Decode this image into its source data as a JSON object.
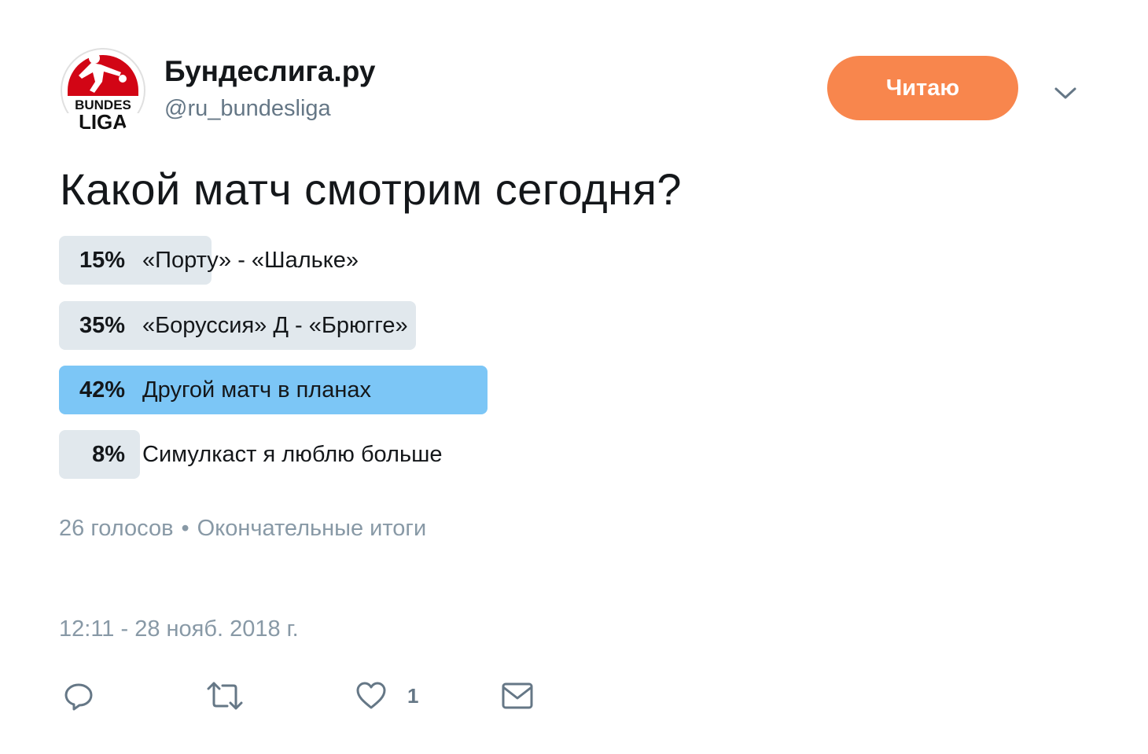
{
  "author": {
    "name": "Бундеслига.ру",
    "handle": "@ru_bundesliga",
    "avatar_icon": "bundesliga-logo",
    "avatar_text_top": "BUNDES",
    "avatar_text_bottom": "LIGA"
  },
  "follow_button": {
    "label": "Читаю",
    "color": "#f8864d"
  },
  "menu_icon": "chevron-down-icon",
  "question": "Какой матч смотрим сегодня?",
  "poll": {
    "options": [
      {
        "percent": "15%",
        "value": 15,
        "label": "«Порту» - «Шальке»"
      },
      {
        "percent": "35%",
        "value": 35,
        "label": "«Боруссия» Д - «Брюгге»"
      },
      {
        "percent": "42%",
        "value": 42,
        "label": "Другой матч в планах",
        "winner": true
      },
      {
        "percent": "8%",
        "value": 8,
        "label": "Симулкаст я люблю больше"
      }
    ],
    "votes": "26 голосов",
    "separator": "•",
    "status": "Окончательные итоги",
    "bar_color": "#e1e8ed",
    "winner_color": "#7cc6f6"
  },
  "timestamp": "12:11 - 28 нояб. 2018 г.",
  "actions": {
    "reply_icon": "reply-icon",
    "retweet_icon": "retweet-icon",
    "like_icon": "heart-icon",
    "like_count": "1",
    "message_icon": "envelope-icon"
  }
}
